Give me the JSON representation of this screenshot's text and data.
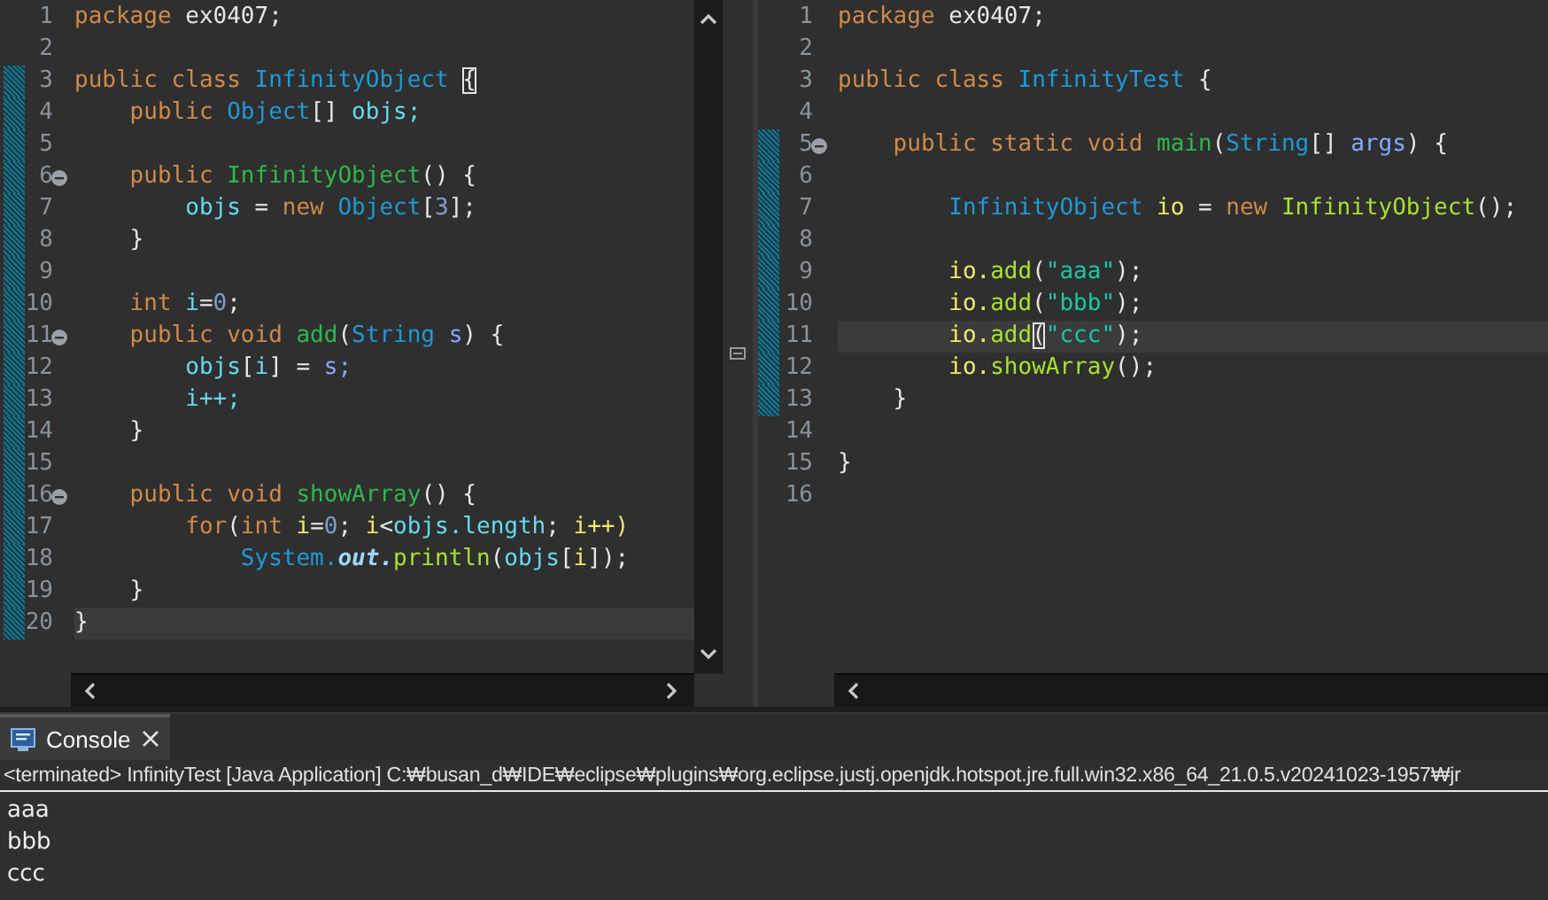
{
  "editors": [
    {
      "scrollbar": true,
      "lines": [
        {
          "number": "1",
          "fold": false,
          "changed": false,
          "current": false,
          "tokens": [
            {
              "kind": "kw",
              "text": "package "
            },
            {
              "kind": "plain",
              "text": "ex0407;"
            }
          ]
        },
        {
          "number": "2",
          "fold": false,
          "changed": false,
          "current": false
        },
        {
          "number": "3",
          "fold": false,
          "changed": true,
          "current": false,
          "tokens": [
            {
              "kind": "kw",
              "text": "public class "
            },
            {
              "kind": "type",
              "text": "InfinityObject "
            },
            {
              "kind": "match",
              "text": "{"
            }
          ]
        },
        {
          "number": "4",
          "fold": false,
          "changed": true,
          "current": false,
          "tokens": [
            {
              "kind": "kw",
              "text": "    public "
            },
            {
              "kind": "type",
              "text": "Object"
            },
            {
              "kind": "plain",
              "text": "[] "
            },
            {
              "kind": "field",
              "text": "objs;"
            }
          ]
        },
        {
          "number": "5",
          "fold": false,
          "changed": true,
          "current": false
        },
        {
          "number": "6",
          "fold": true,
          "changed": true,
          "current": false,
          "tokens": [
            {
              "kind": "kw",
              "text": "    public "
            },
            {
              "kind": "decl",
              "text": "InfinityObject"
            },
            {
              "kind": "plain",
              "text": "() {"
            }
          ]
        },
        {
          "number": "7",
          "fold": false,
          "changed": true,
          "current": false,
          "tokens": [
            {
              "kind": "field",
              "text": "        objs"
            },
            {
              "kind": "plain",
              "text": " = "
            },
            {
              "kind": "kw",
              "text": "new "
            },
            {
              "kind": "type",
              "text": "Object"
            },
            {
              "kind": "plain",
              "text": "["
            },
            {
              "kind": "num",
              "text": "3"
            },
            {
              "kind": "plain",
              "text": "];"
            }
          ]
        },
        {
          "number": "8",
          "fold": false,
          "changed": true,
          "current": false,
          "tokens": [
            {
              "kind": "plain",
              "text": "    }"
            }
          ]
        },
        {
          "number": "9",
          "fold": false,
          "changed": true,
          "current": false
        },
        {
          "number": "10",
          "fold": false,
          "changed": true,
          "current": false,
          "tokens": [
            {
              "kind": "kw",
              "text": "    int "
            },
            {
              "kind": "field",
              "text": "i"
            },
            {
              "kind": "plain",
              "text": "="
            },
            {
              "kind": "num",
              "text": "0"
            },
            {
              "kind": "plain",
              "text": ";"
            }
          ]
        },
        {
          "number": "11",
          "fold": true,
          "changed": true,
          "current": false,
          "tokens": [
            {
              "kind": "kw",
              "text": "    public void "
            },
            {
              "kind": "decl",
              "text": "add"
            },
            {
              "kind": "plain",
              "text": "("
            },
            {
              "kind": "type",
              "text": "String "
            },
            {
              "kind": "param",
              "text": "s"
            },
            {
              "kind": "plain",
              "text": ") {"
            }
          ]
        },
        {
          "number": "12",
          "fold": false,
          "changed": true,
          "current": false,
          "tokens": [
            {
              "kind": "field",
              "text": "        objs"
            },
            {
              "kind": "plain",
              "text": "["
            },
            {
              "kind": "field",
              "text": "i"
            },
            {
              "kind": "plain",
              "text": "] = "
            },
            {
              "kind": "param",
              "text": "s;"
            }
          ]
        },
        {
          "number": "13",
          "fold": false,
          "changed": true,
          "current": false,
          "tokens": [
            {
              "kind": "field",
              "text": "        i++;"
            }
          ]
        },
        {
          "number": "14",
          "fold": false,
          "changed": true,
          "current": false,
          "tokens": [
            {
              "kind": "plain",
              "text": "    }"
            }
          ]
        },
        {
          "number": "15",
          "fold": false,
          "changed": true,
          "current": false
        },
        {
          "number": "16",
          "fold": true,
          "changed": true,
          "current": false,
          "tokens": [
            {
              "kind": "kw",
              "text": "    public void "
            },
            {
              "kind": "decl",
              "text": "showArray"
            },
            {
              "kind": "plain",
              "text": "() {"
            }
          ]
        },
        {
          "number": "17",
          "fold": false,
          "changed": true,
          "current": false,
          "tokens": [
            {
              "kind": "kw",
              "text": "        for"
            },
            {
              "kind": "plain",
              "text": "("
            },
            {
              "kind": "kw",
              "text": "int "
            },
            {
              "kind": "local",
              "text": "i"
            },
            {
              "kind": "plain",
              "text": "="
            },
            {
              "kind": "num",
              "text": "0"
            },
            {
              "kind": "plain",
              "text": "; "
            },
            {
              "kind": "local",
              "text": "i"
            },
            {
              "kind": "plain",
              "text": "<"
            },
            {
              "kind": "field",
              "text": "objs.length"
            },
            {
              "kind": "plain",
              "text": "; "
            },
            {
              "kind": "local",
              "text": "i++)"
            }
          ]
        },
        {
          "number": "18",
          "fold": false,
          "changed": true,
          "current": false,
          "tokens": [
            {
              "kind": "type",
              "text": "            System."
            },
            {
              "kind": "static",
              "text": "out."
            },
            {
              "kind": "call",
              "text": "println"
            },
            {
              "kind": "plain",
              "text": "("
            },
            {
              "kind": "field",
              "text": "objs"
            },
            {
              "kind": "plain",
              "text": "["
            },
            {
              "kind": "local",
              "text": "i"
            },
            {
              "kind": "plain",
              "text": "]);"
            }
          ]
        },
        {
          "number": "19",
          "fold": false,
          "changed": true,
          "current": false,
          "tokens": [
            {
              "kind": "plain",
              "text": "    }"
            }
          ]
        },
        {
          "number": "20",
          "fold": false,
          "changed": true,
          "current": true,
          "tokens": [
            {
              "kind": "plain",
              "text": "}"
            }
          ]
        }
      ]
    },
    {
      "scrollbar": false,
      "lines": [
        {
          "number": "1",
          "fold": false,
          "changed": false,
          "current": false,
          "tokens": [
            {
              "kind": "kw",
              "text": "package "
            },
            {
              "kind": "plain",
              "text": "ex0407;"
            }
          ]
        },
        {
          "number": "2",
          "fold": false,
          "changed": false,
          "current": false
        },
        {
          "number": "3",
          "fold": false,
          "changed": false,
          "current": false,
          "tokens": [
            {
              "kind": "kw",
              "text": "public class "
            },
            {
              "kind": "type",
              "text": "InfinityTest "
            },
            {
              "kind": "plain",
              "text": "{"
            }
          ]
        },
        {
          "number": "4",
          "fold": false,
          "changed": false,
          "current": false
        },
        {
          "number": "5",
          "fold": true,
          "changed": true,
          "current": false,
          "tokens": [
            {
              "kind": "kw",
              "text": "    public static void "
            },
            {
              "kind": "decl",
              "text": "main"
            },
            {
              "kind": "plain",
              "text": "("
            },
            {
              "kind": "type",
              "text": "String"
            },
            {
              "kind": "plain",
              "text": "[] "
            },
            {
              "kind": "param",
              "text": "args"
            },
            {
              "kind": "plain",
              "text": ") {"
            }
          ]
        },
        {
          "number": "6",
          "fold": false,
          "changed": true,
          "current": false
        },
        {
          "number": "7",
          "fold": false,
          "changed": true,
          "current": false,
          "tokens": [
            {
              "kind": "type",
              "text": "        InfinityObject "
            },
            {
              "kind": "local",
              "text": "io"
            },
            {
              "kind": "plain",
              "text": " = "
            },
            {
              "kind": "kw",
              "text": "new "
            },
            {
              "kind": "call",
              "text": "InfinityObject"
            },
            {
              "kind": "plain",
              "text": "();"
            }
          ]
        },
        {
          "number": "8",
          "fold": false,
          "changed": true,
          "current": false
        },
        {
          "number": "9",
          "fold": false,
          "changed": true,
          "current": false,
          "tokens": [
            {
              "kind": "local",
              "text": "        io."
            },
            {
              "kind": "call",
              "text": "add"
            },
            {
              "kind": "plain",
              "text": "("
            },
            {
              "kind": "str",
              "text": "\"aaa\""
            },
            {
              "kind": "plain",
              "text": ");"
            }
          ]
        },
        {
          "number": "10",
          "fold": false,
          "changed": true,
          "current": false,
          "tokens": [
            {
              "kind": "local",
              "text": "        io."
            },
            {
              "kind": "call",
              "text": "add"
            },
            {
              "kind": "plain",
              "text": "("
            },
            {
              "kind": "str",
              "text": "\"bbb\""
            },
            {
              "kind": "plain",
              "text": ");"
            }
          ]
        },
        {
          "number": "11",
          "fold": false,
          "changed": true,
          "current": true,
          "tokens": [
            {
              "kind": "local",
              "text": "        io."
            },
            {
              "kind": "call",
              "text": "add"
            },
            {
              "kind": "match",
              "text": "("
            },
            {
              "kind": "str",
              "text": "\"ccc\""
            },
            {
              "kind": "plain",
              "text": ");"
            }
          ]
        },
        {
          "number": "12",
          "fold": false,
          "changed": true,
          "current": false,
          "tokens": [
            {
              "kind": "local",
              "text": "        io."
            },
            {
              "kind": "call",
              "text": "showArray"
            },
            {
              "kind": "plain",
              "text": "();"
            }
          ]
        },
        {
          "number": "13",
          "fold": false,
          "changed": true,
          "current": false,
          "tokens": [
            {
              "kind": "plain",
              "text": "    }"
            }
          ]
        },
        {
          "number": "14",
          "fold": false,
          "changed": false,
          "current": false
        },
        {
          "number": "15",
          "fold": false,
          "changed": false,
          "current": false,
          "tokens": [
            {
              "kind": "plain",
              "text": "}"
            }
          ]
        },
        {
          "number": "16",
          "fold": false,
          "changed": false,
          "current": false
        }
      ]
    }
  ],
  "console": {
    "tabs": [
      {
        "label": "Console",
        "selected": true
      }
    ],
    "status": "<terminated> InfinityTest [Java Application] C:₩busan_d₩IDE₩eclipse₩plugins₩org.eclipse.justj.openjdk.hotspot.jre.full.win32.x86_64_21.0.5.v20241023-1957₩jr",
    "output": [
      "aaa",
      "bbb",
      "ccc"
    ]
  }
}
